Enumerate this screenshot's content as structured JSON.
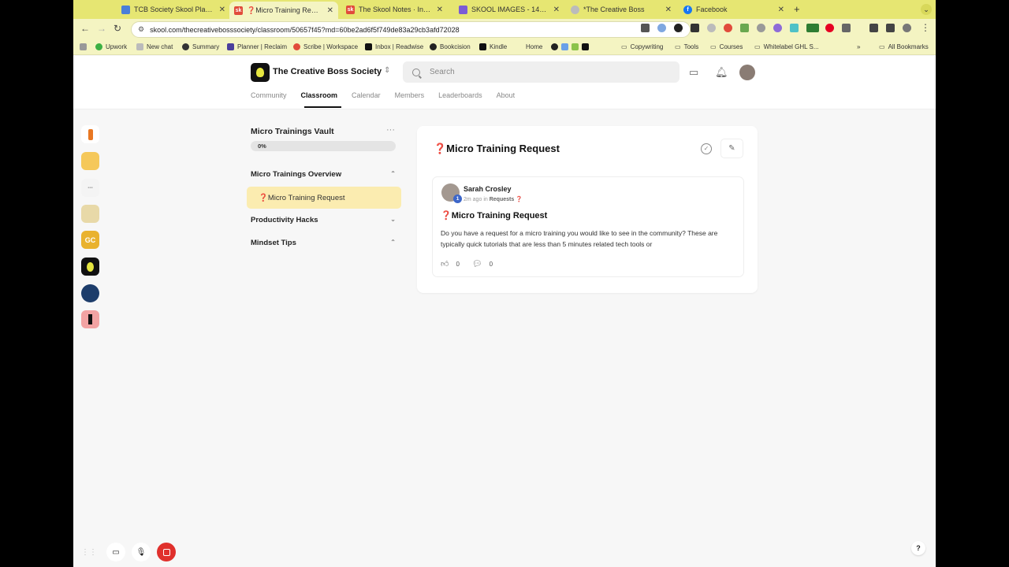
{
  "browser": {
    "tabs": [
      {
        "title": "TCB Society Skool Plan - Go...",
        "favicon_color": "#4a7fd8"
      },
      {
        "title": "❓Micro Training Request - M...",
        "favicon_color": "#e14b3b",
        "active": true
      },
      {
        "title": "The Skool Notes · Invite-Only...",
        "favicon_color": "#e14b3b"
      },
      {
        "title": "SKOOL IMAGES - 1400 × 79...",
        "favicon_color": "#7b5cd6"
      },
      {
        "title": "*The Creative Boss",
        "favicon_color": "#aaaaaa"
      },
      {
        "title": "Facebook",
        "favicon_color": "#1877f2"
      }
    ],
    "url": "skool.com/thecreativebosssociety/classroom/50657f45?md=60be2ad6f5f749de83a29cb3afd72028",
    "bookmarks": [
      "Upwork",
      "New chat",
      "Summary",
      "Planner | Reclaim",
      "Scribe | Workspace",
      "Inbox | Readwise",
      "Bookcision",
      "Kindle",
      "Home",
      "Copywriting",
      "Tools",
      "Courses",
      "Whitelabel GHL S...",
      "All Bookmarks"
    ]
  },
  "header": {
    "group_name": "The Creative Boss Society",
    "search_placeholder": "Search",
    "nav": [
      "Community",
      "Classroom",
      "Calendar",
      "Members",
      "Leaderboards",
      "About"
    ],
    "active_nav": "Classroom"
  },
  "rail": {
    "gc_label": "GC"
  },
  "course": {
    "title": "Micro Trainings Vault",
    "progress": 0,
    "progress_label": "0%",
    "sections": [
      {
        "title": "Micro Trainings Overview",
        "expanded": true
      },
      {
        "title": "Productivity Hacks",
        "expanded": false
      },
      {
        "title": "Mindset Tips",
        "expanded": true
      }
    ],
    "active_lesson": "❓Micro Training Request"
  },
  "lesson": {
    "title": "❓Micro Training Request",
    "post": {
      "author": "Sarah Crosley",
      "level": "1",
      "time": "2m ago",
      "in_label": "in",
      "category": "Requests",
      "category_icon": "❓",
      "title": "❓Micro Training Request",
      "body": "Do you have a request for a micro training you would like to see in the community? These are typically quick tutorials that are less than 5 minutes related tech tools or",
      "likes": "0",
      "comments": "0"
    }
  },
  "help_label": "?",
  "colors": {
    "tab_strip": "#e6e672",
    "toolbar": "#f4f4c2",
    "active_lesson_bg": "#fbecb0",
    "record_red": "#e0302c"
  }
}
